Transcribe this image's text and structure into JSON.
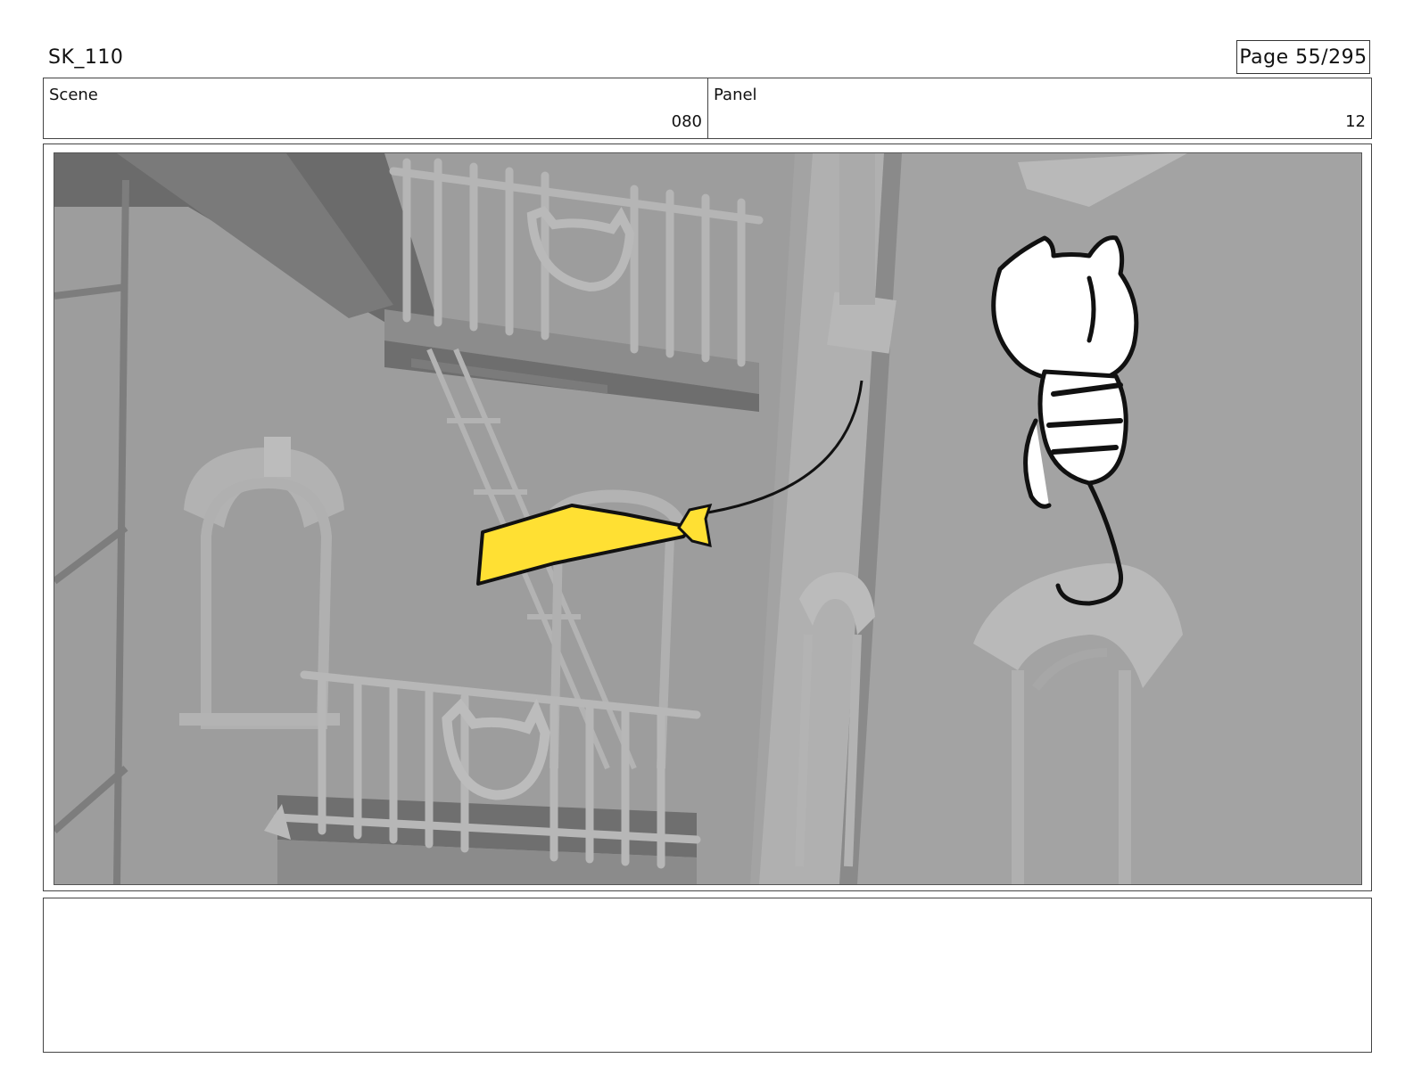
{
  "header": {
    "sheet_id": "SK_110",
    "page_label": "Page",
    "page_number": "55/295"
  },
  "info": {
    "scene_label": "Scene",
    "scene_value": "080",
    "panel_label": "Panel",
    "panel_value": "12"
  },
  "colors": {
    "kite_yellow": "#ffe033",
    "wall_gray": "#9d9d9d",
    "shadow_gray": "#6e6e6e"
  },
  "notes": {
    "text": ""
  }
}
